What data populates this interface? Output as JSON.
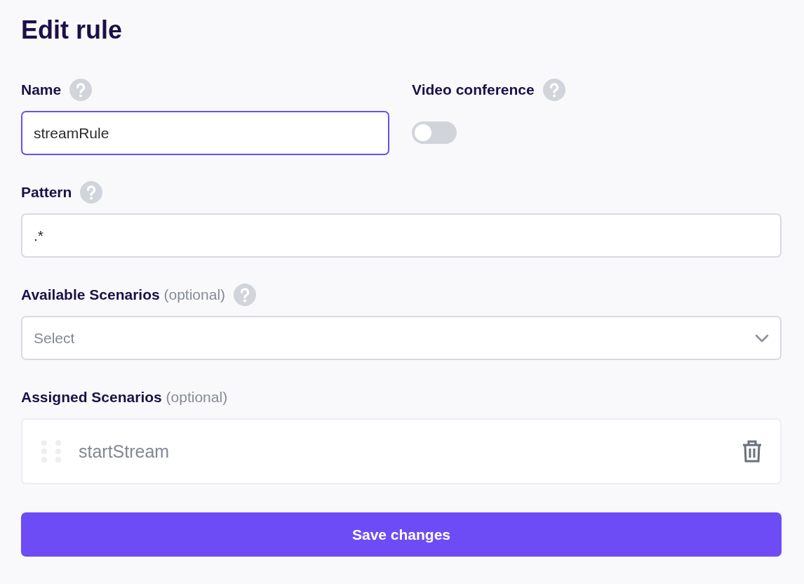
{
  "title": "Edit rule",
  "name_field": {
    "label": "Name",
    "value": "streamRule",
    "focused": true
  },
  "video_conference": {
    "label": "Video conference",
    "on": false
  },
  "pattern_field": {
    "label": "Pattern",
    "value": ".*",
    "focused": false
  },
  "available_scenarios": {
    "label": "Available Scenarios",
    "optional": "(optional)",
    "placeholder": "Select"
  },
  "assigned_scenarios": {
    "label": "Assigned Scenarios",
    "optional": "(optional)",
    "items": [
      {
        "name": "startStream"
      }
    ]
  },
  "save_button": {
    "label": "Save changes"
  }
}
